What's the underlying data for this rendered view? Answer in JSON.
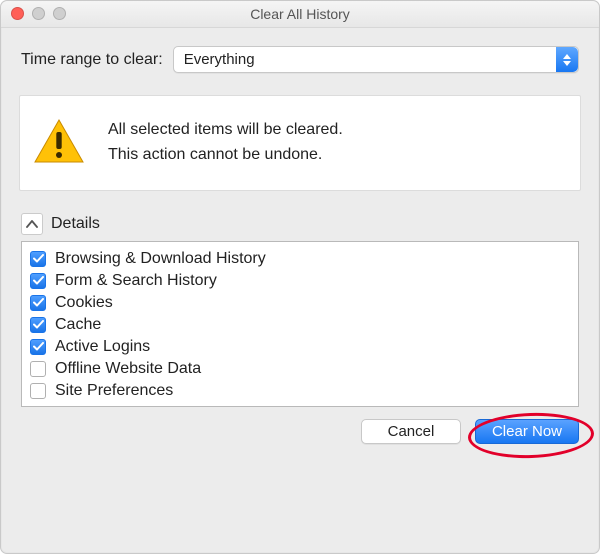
{
  "window": {
    "title": "Clear All History"
  },
  "range": {
    "label": "Time range to clear:",
    "selected": "Everything"
  },
  "warning": {
    "line1": "All selected items will be cleared.",
    "line2": "This action cannot be undone."
  },
  "details": {
    "label": "Details",
    "expanded": true,
    "items": [
      {
        "label": "Browsing & Download History",
        "checked": true
      },
      {
        "label": "Form & Search History",
        "checked": true
      },
      {
        "label": "Cookies",
        "checked": true
      },
      {
        "label": "Cache",
        "checked": true
      },
      {
        "label": "Active Logins",
        "checked": true
      },
      {
        "label": "Offline Website Data",
        "checked": false
      },
      {
        "label": "Site Preferences",
        "checked": false
      }
    ]
  },
  "buttons": {
    "cancel": "Cancel",
    "clear": "Clear Now"
  },
  "annotation": {
    "primary_highlighted": true
  }
}
